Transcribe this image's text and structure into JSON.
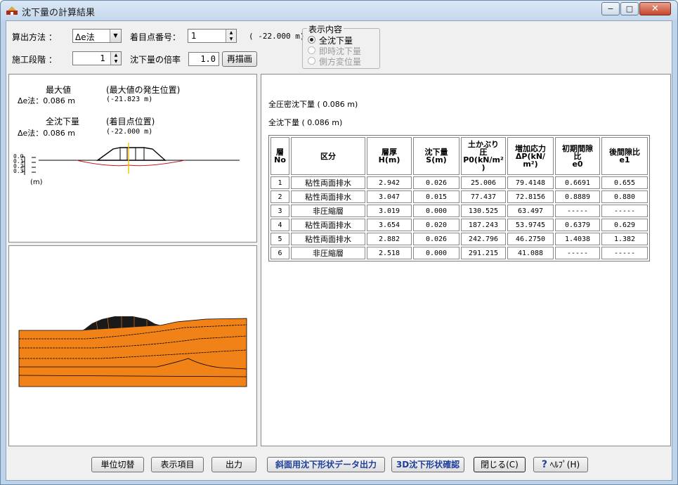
{
  "window": {
    "title": "沈下量の計算結果",
    "min_glyph": "−",
    "max_glyph": "□",
    "close_glyph": "✕"
  },
  "controls": {
    "method_label": "算出方法 ：",
    "method_value": "Δe法",
    "point_label": "着目点番号：",
    "point_value": "1",
    "point_position": "( -22.000 m)",
    "stage_label": "施工段階 ：",
    "stage_value": "1",
    "ratio_label": "沈下量の倍率",
    "ratio_value": "1.0",
    "redraw_button": "再描画"
  },
  "display_group": {
    "legend": "表示内容",
    "options": [
      {
        "label": "全沈下量",
        "selected": true,
        "enabled": true
      },
      {
        "label": "即時沈下量",
        "selected": false,
        "enabled": false
      },
      {
        "label": "側方変位量",
        "selected": false,
        "enabled": false
      }
    ]
  },
  "left_panel": {
    "max_title": "最大値",
    "max_pos_title": "(最大値の発生位置)",
    "max_row_label": "Δe法：0.086 m",
    "max_row_pos": "(-21.823 m)",
    "total_title": "全沈下量",
    "total_pos_title": "(着目点位置)",
    "total_row_label": "Δe法：0.086 m",
    "total_row_pos": "(-22.000 m)",
    "scale_ticks": [
      "0.0",
      "0.1",
      "0.2",
      "0.3"
    ],
    "scale_unit": "(m)"
  },
  "right_panel": {
    "consolidation_line": "全圧密沈下量 ( 0.086 m)",
    "total_line": "全沈下量 ( 0.086 m)",
    "headers": [
      "層\nNo",
      "区分",
      "層厚\nH(m)",
      "沈下量\nS(m)",
      "土かぶり\n圧\nP0(kN/m²\n)",
      "増加応力\nΔP(kN/\nm²)",
      "初期間隙\n比\ne0",
      "後間隙比\ne1"
    ],
    "rows": [
      [
        "1",
        "粘性両面排水",
        "2.942",
        "0.026",
        "25.006",
        "79.4148",
        "0.6691",
        "0.655"
      ],
      [
        "2",
        "粘性両面排水",
        "3.047",
        "0.015",
        "77.437",
        "72.8156",
        "0.8889",
        "0.880"
      ],
      [
        "3",
        "非圧縮層",
        "3.019",
        "0.000",
        "130.525",
        "63.497",
        "-----",
        "-----"
      ],
      [
        "4",
        "粘性両面排水",
        "3.654",
        "0.020",
        "187.243",
        "53.9745",
        "0.6379",
        "0.629"
      ],
      [
        "5",
        "粘性両面排水",
        "2.882",
        "0.026",
        "242.796",
        "46.2750",
        "1.4038",
        "1.382"
      ],
      [
        "6",
        "非圧縮層",
        "2.518",
        "0.000",
        "291.215",
        "41.088",
        "-----",
        "-----"
      ]
    ]
  },
  "footer": {
    "unit_button": "単位切替",
    "items_button": "表示項目",
    "output_button": "出力",
    "slope_button": "斜面用沈下形状データ出力",
    "3d_button": "3D沈下形状確認",
    "close_button": "閉じる(C)",
    "help_button": "ﾍﾙﾌﾟ(H)"
  },
  "colors": {
    "soil": "#f08218",
    "embankment": "#1a1a1a",
    "axis_marker": "#f2c200",
    "settlement_curve": "#c01818"
  }
}
